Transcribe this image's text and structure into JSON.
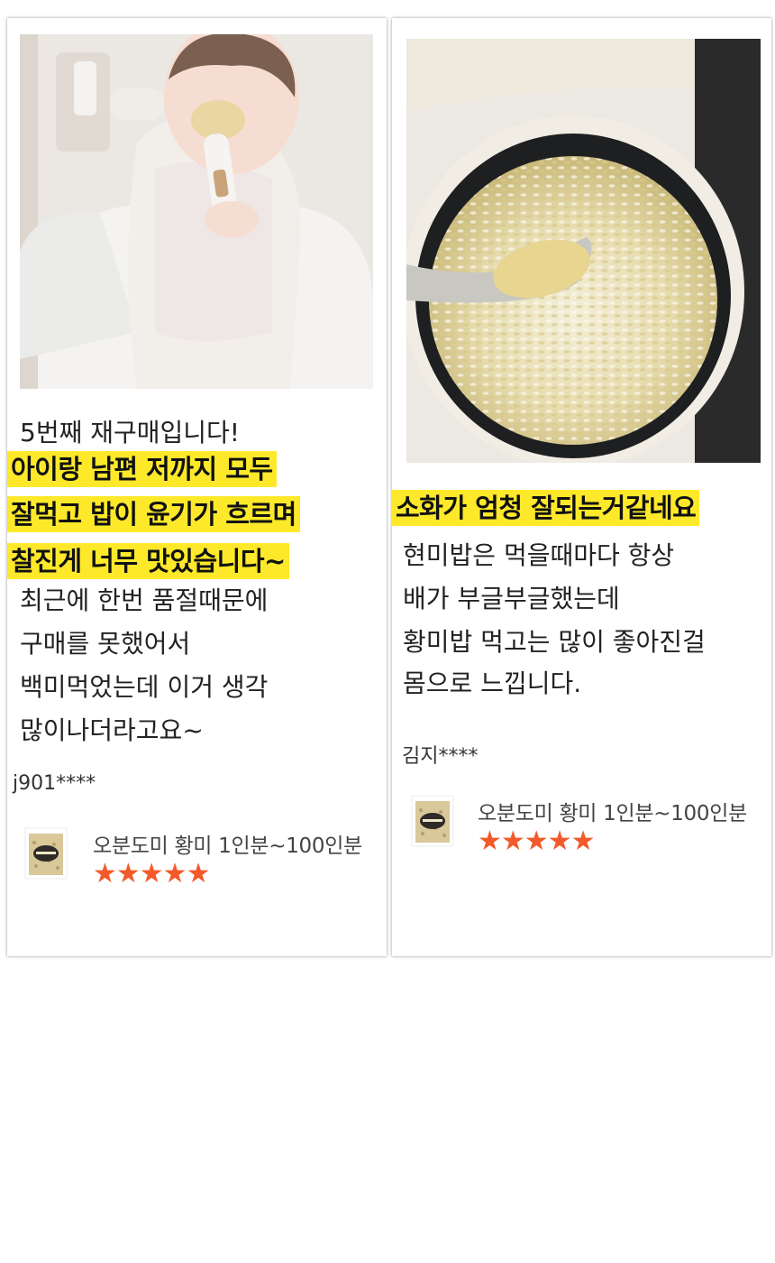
{
  "reviews": [
    {
      "intro": "5번째 재구매입니다!",
      "highlights": [
        "아이랑 남편 저까지 모두",
        "잘먹고 밥이 윤기가 흐르며",
        "찰진게 너무 맛있습니다~"
      ],
      "body": [
        "최근에 한번 품절때문에",
        "구매를 못했어서",
        "백미먹었는데 이거 생각",
        "많이나더라고요~"
      ],
      "reviewer": "j901****",
      "product_name": "오분도미 황미 1인분~100인분",
      "rating": 5,
      "stars": "★★★★★",
      "photo_icon": "baby-eating-rice-photo"
    },
    {
      "highlights": [
        "소화가 엄청 잘되는거같네요"
      ],
      "body": [
        "현미밥은 먹을때마다 항상",
        "배가 부글부글했는데",
        "황미밥 먹고는 많이 좋아진걸",
        "몸으로 느낍니다."
      ],
      "reviewer": "김지****",
      "product_name": "오분도미 황미 1인분~100인분",
      "rating": 5,
      "stars": "★★★★★",
      "photo_icon": "rice-cooker-photo"
    }
  ],
  "colors": {
    "highlight": "#fde92a",
    "star": "#f25a2a"
  }
}
